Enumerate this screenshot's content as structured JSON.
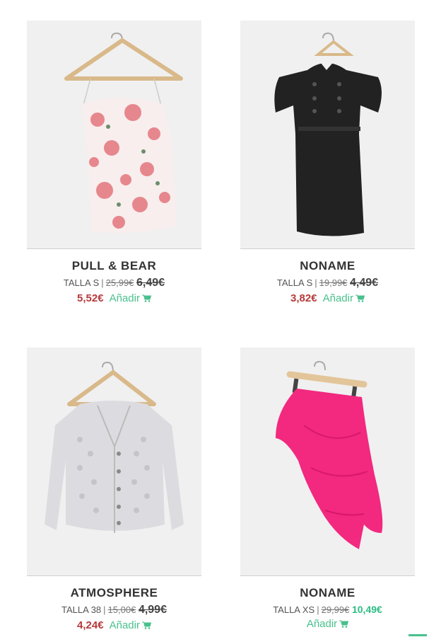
{
  "products": [
    {
      "brand": "PULL & BEAR",
      "size": "TALLA S",
      "original_price": "25,99€",
      "price": "6,49€",
      "sale_price": "5,52€",
      "add_label": "Añadir",
      "icon": "cart-icon",
      "item_color": "#f2c8c8"
    },
    {
      "brand": "NONAME",
      "size": "TALLA S",
      "original_price": "19,99€",
      "price": "4,49€",
      "sale_price": "3,82€",
      "add_label": "Añadir",
      "icon": "cart-icon",
      "item_color": "#222222"
    },
    {
      "brand": "ATMOSPHERE",
      "size": "TALLA 38",
      "original_price": "15,00€",
      "price": "4,99€",
      "sale_price": "4,24€",
      "add_label": "Añadir",
      "icon": "cart-icon",
      "item_color": "#d6d6dc"
    },
    {
      "brand": "NONAME",
      "size": "TALLA XS",
      "original_price": "29,99€",
      "price": "10,49€",
      "add_label": "Añadir",
      "icon": "cart-icon",
      "item_color": "#f2297f"
    }
  ],
  "colors": {
    "sale": "#b63a3a",
    "add": "#49c08c",
    "image_bg": "#f0f0f0"
  }
}
